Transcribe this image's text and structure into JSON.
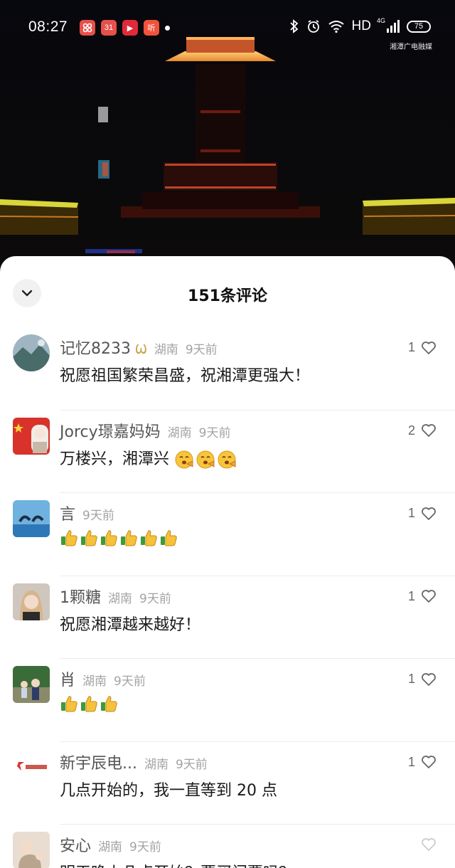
{
  "status_bar": {
    "time": "08:27",
    "app_icons": [
      {
        "name": "app-icon-1",
        "glyph": "",
        "color": "#e8504a"
      },
      {
        "name": "app-icon-2",
        "glyph": "31",
        "color": "#e8504a"
      },
      {
        "name": "app-icon-3",
        "glyph": "▶",
        "color": "#e02a3a"
      },
      {
        "name": "app-icon-4",
        "glyph": "听",
        "color": "#f0533c"
      }
    ],
    "network": "HD",
    "cell": "4G",
    "battery": "75"
  },
  "watermark": "湘潭广电融媒",
  "sheet": {
    "title": "151条评论"
  },
  "comments": [
    {
      "username": "记忆8233",
      "badge": "Ѡ",
      "location": "湖南",
      "time": "9天前",
      "text": "祝愿祖国繁荣昌盛，祝湘潭更强大！",
      "likes": "1",
      "emoji_count": 0
    },
    {
      "username": "Jorcy璟嘉妈妈",
      "badge": "",
      "location": "湖南",
      "time": "9天前",
      "text": "万楼兴，湘潭兴",
      "likes": "2",
      "emoji_count": 3,
      "emoji_type": "face"
    },
    {
      "username": "言",
      "badge": "",
      "location": "",
      "time": "9天前",
      "text": "",
      "likes": "1",
      "emoji_count": 6,
      "emoji_type": "thumb"
    },
    {
      "username": "1颗糖",
      "badge": "",
      "location": "湖南",
      "time": "9天前",
      "text": "祝愿湘潭越来越好！",
      "likes": "1",
      "emoji_count": 0
    },
    {
      "username": "肖",
      "badge": "",
      "location": "湖南",
      "time": "9天前",
      "text": "",
      "likes": "1",
      "emoji_count": 3,
      "emoji_type": "thumb"
    },
    {
      "username": "新宇辰电...",
      "badge": "",
      "location": "湖南",
      "time": "9天前",
      "text": "几点开始的，我一直等到 20 点",
      "likes": "1",
      "emoji_count": 0
    },
    {
      "username": "安心",
      "badge": "",
      "location": "湖南",
      "time": "9天前",
      "text": "明天晚上几点开始？要买门票吗？",
      "likes": "",
      "emoji_count": 0
    }
  ],
  "colors": {
    "accent_text": "#1a1a1a",
    "meta_text": "#a3a3a3",
    "sheet_bg": "#ffffff"
  }
}
